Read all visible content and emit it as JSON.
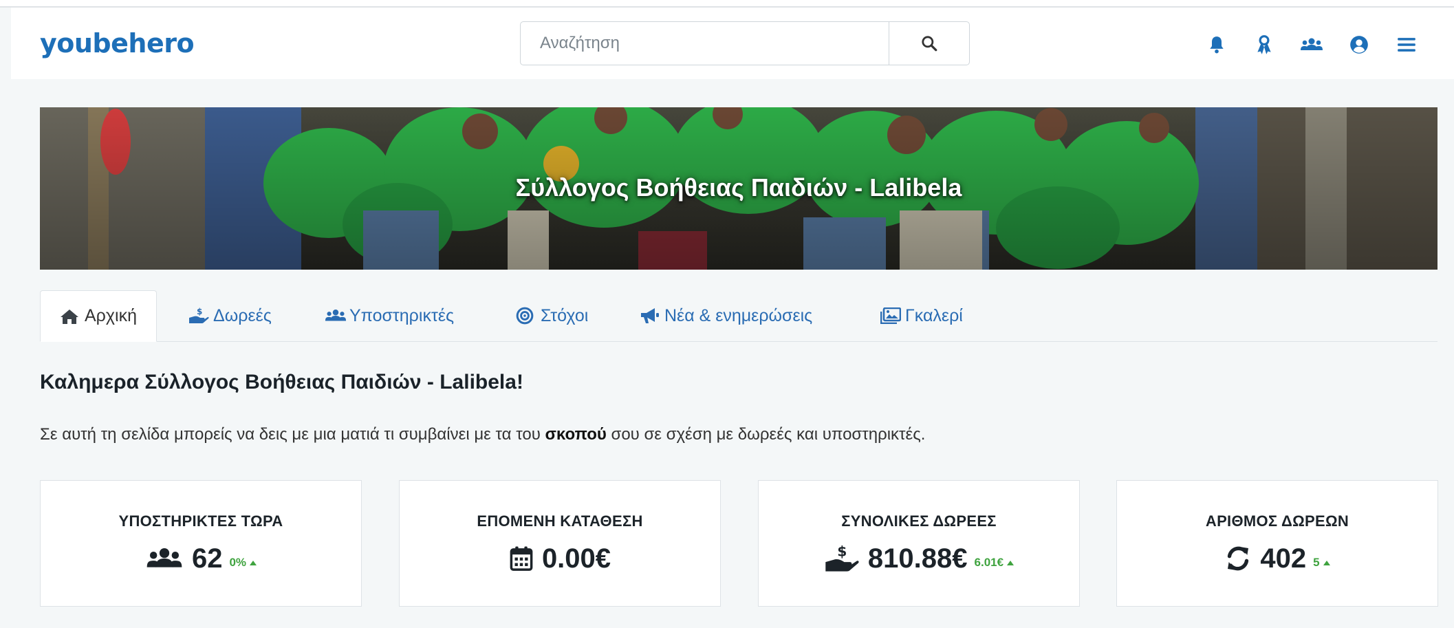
{
  "header": {
    "logo": "youbehero",
    "search_placeholder": "Αναζήτηση",
    "icons": [
      "bell-icon",
      "ribbon-icon",
      "users-icon",
      "user-circle-icon",
      "menu-icon"
    ]
  },
  "banner": {
    "title": "Σύλλογος Βοήθειας Παιδιών - Lalibela"
  },
  "tabs": [
    {
      "label": "Αρχική",
      "icon": "home-icon",
      "active": true
    },
    {
      "label": "Δωρεές",
      "icon": "donate-hand-icon"
    },
    {
      "label": "Υποστηρικτές",
      "icon": "users-icon"
    },
    {
      "label": "Στόχοι",
      "icon": "target-icon"
    },
    {
      "label": "Νέα & ενημερώσεις",
      "icon": "megaphone-icon"
    },
    {
      "label": "Γκαλερί",
      "icon": "gallery-icon"
    }
  ],
  "greeting": "Καλημερα Σύλλογος Βοήθειας Παιδιών - Lalibela!",
  "description": {
    "before": "Σε αυτή τη σελίδα μπορείς να δεις με μια ματιά τι συμβαίνει με τα του ",
    "bold": "σκοπού",
    "after": " σου σε σχέση με δωρεές και υποστηρικτές."
  },
  "stats": [
    {
      "label": "ΥΠΟΣΤΗΡΙΚΤΕΣ ΤΩΡΑ",
      "value": "62",
      "delta": "0%",
      "icon": "users-icon"
    },
    {
      "label": "ΕΠΟΜΕΝΗ ΚΑΤΑΘΕΣΗ",
      "value": "0.00€",
      "delta": "",
      "icon": "calendar-icon"
    },
    {
      "label": "ΣΥΝΟΛΙΚΕΣ ΔΩΡΕΕΣ",
      "value": "810.88€",
      "delta": "6.01€",
      "icon": "donate-hand-icon"
    },
    {
      "label": "ΑΡΙΘΜΟΣ ΔΩΡΕΩΝ",
      "value": "402",
      "delta": "5",
      "icon": "refresh-icon"
    }
  ],
  "colors": {
    "brand": "#1d6fb8",
    "link": "#2a6cb3",
    "positive": "#3fa33f",
    "banner_shirts": "#2fb34a"
  }
}
